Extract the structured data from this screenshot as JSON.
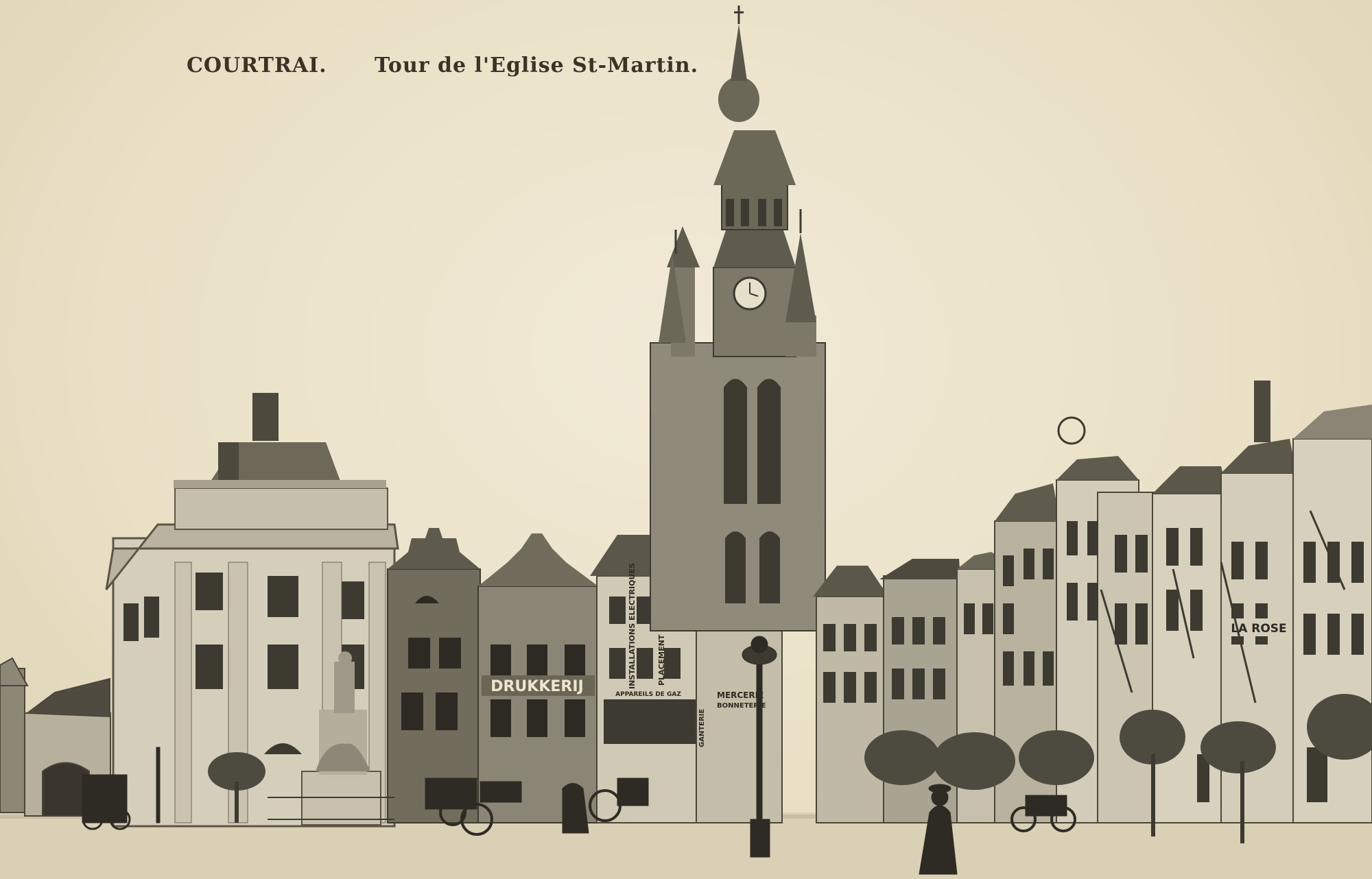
{
  "caption": {
    "city": "COURTRAI.",
    "subject": "Tour de l'Eglise St-Martin."
  },
  "signs": {
    "drukkerij": "DRUKKERIJ",
    "la_rose": "LA ROSE",
    "mercerie": "MERCERIE",
    "bonneterie": "BONNETERIE",
    "ganterie": "GANTERIE",
    "installations": "INSTALLATIONS ELECTRIQUES",
    "placement": "PLACEMENT DE GAZ",
    "appareils": "APPAREILS DE GAZ"
  },
  "colors": {
    "paper": "#ece4cd",
    "ink": "#3b3426",
    "sepia_dark": "#3d3a31",
    "sepia_mid": "#7b7666",
    "sepia_light": "#bdb7a4"
  }
}
